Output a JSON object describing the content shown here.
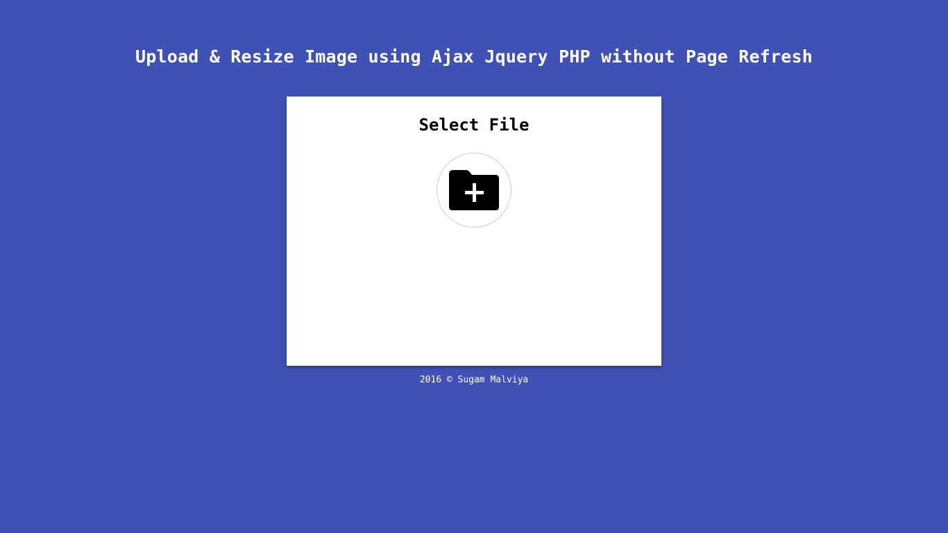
{
  "page": {
    "title": "Upload & Resize Image using Ajax Jquery PHP without Page Refresh",
    "background_color": "#3f51b5"
  },
  "upload_card": {
    "heading": "Select File",
    "button_icon": "folder-plus-icon"
  },
  "footer": {
    "text": "2016 © Sugam Malviya"
  }
}
